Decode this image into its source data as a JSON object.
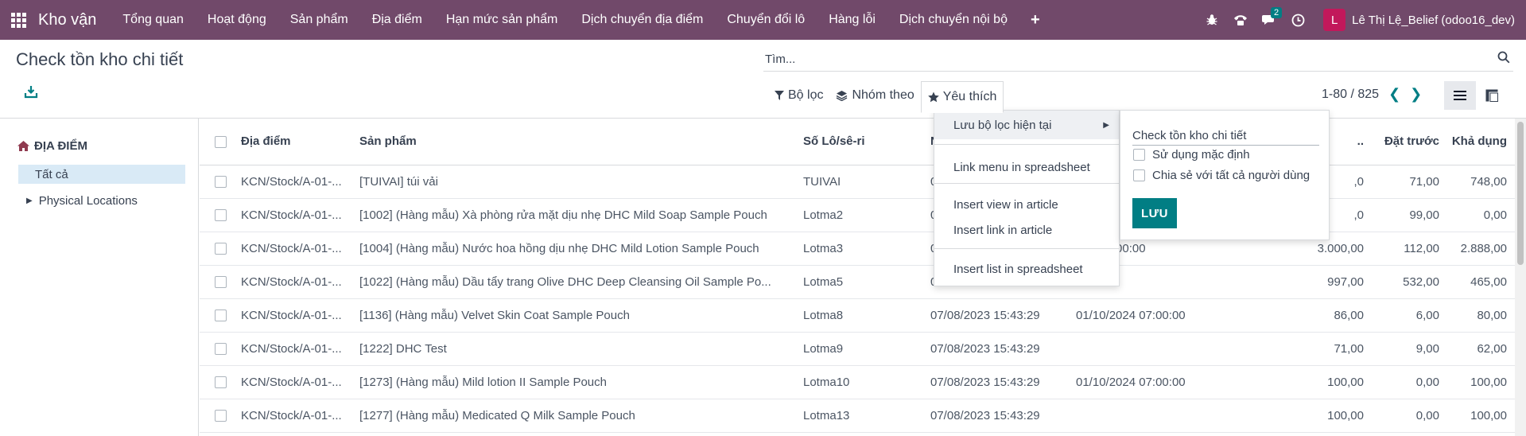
{
  "navbar": {
    "app_name": "Kho vận",
    "menus": [
      "Tổng quan",
      "Hoạt động",
      "Sản phẩm",
      "Địa điểm",
      "Hạn mức sản phẩm",
      "Dịch chuyển địa điểm",
      "Chuyển đổi lô",
      "Hàng lỗi",
      "Dịch chuyển nội bộ"
    ],
    "chat_badge": "2",
    "avatar_letter": "L",
    "user_name": "Lê Thị Lệ_Belief (odoo16_dev)"
  },
  "control_panel": {
    "title": "Check tồn kho chi tiết",
    "search_placeholder": "Tìm...",
    "filter_label": "Bộ lọc",
    "group_label": "Nhóm theo",
    "favorite_label": "Yêu thích",
    "pager": "1-80 / 825"
  },
  "sidebar": {
    "header": "ĐỊA ĐIỂM",
    "all_label": "Tất cả",
    "physical_label": "Physical Locations"
  },
  "table": {
    "headers": {
      "location": "Địa điểm",
      "product": "Sản phẩm",
      "lot": "Số Lô/sê-ri",
      "date_in": "N",
      "expiry": "",
      "qty": "..",
      "reserved": "Đặt trước",
      "available": "Khả dụng"
    },
    "rows": [
      {
        "location": "KCN/Stock/A-01-...",
        "product": "[TUIVAI] túi vải",
        "lot": "TUIVAI",
        "date_in": "0",
        "expiry": "",
        "qty": ",0",
        "reserved": "71,00",
        "available": "748,00"
      },
      {
        "location": "KCN/Stock/A-01-...",
        "product": "[1002] (Hàng mẫu) Xà phòng rửa mặt dịu nhẹ DHC Mild Soap Sample Pouch",
        "lot": "Lotma2",
        "date_in": "0",
        "expiry": "",
        "qty": ",0",
        "reserved": "99,00",
        "available": "0,00"
      },
      {
        "location": "KCN/Stock/A-01-...",
        "product": "[1004] (Hàng mẫu) Nước hoa hồng dịu nhẹ DHC Mild Lotion Sample Pouch",
        "lot": "Lotma3",
        "date_in": "0",
        "expiry": "023 07:00:00",
        "qty": "3.000,00",
        "reserved": "112,00",
        "available": "2.888,00"
      },
      {
        "location": "KCN/Stock/A-01-...",
        "product": "[1022] (Hàng mẫu) Dầu tẩy trang Olive DHC Deep Cleansing Oil Sample Po...",
        "lot": "Lotma5",
        "date_in": "0",
        "expiry": "",
        "qty": "997,00",
        "reserved": "532,00",
        "available": "465,00"
      },
      {
        "location": "KCN/Stock/A-01-...",
        "product": "[1136] (Hàng mẫu) Velvet Skin Coat Sample Pouch",
        "lot": "Lotma8",
        "date_in": "07/08/2023 15:43:29",
        "expiry": "01/10/2024 07:00:00",
        "qty": "86,00",
        "reserved": "6,00",
        "available": "80,00"
      },
      {
        "location": "KCN/Stock/A-01-...",
        "product": "[1222] DHC Test",
        "lot": "Lotma9",
        "date_in": "07/08/2023 15:43:29",
        "expiry": "",
        "qty": "71,00",
        "reserved": "9,00",
        "available": "62,00"
      },
      {
        "location": "KCN/Stock/A-01-...",
        "product": "[1273] (Hàng mẫu) Mild lotion II Sample Pouch",
        "lot": "Lotma10",
        "date_in": "07/08/2023 15:43:29",
        "expiry": "01/10/2024 07:00:00",
        "qty": "100,00",
        "reserved": "0,00",
        "available": "100,00"
      },
      {
        "location": "KCN/Stock/A-01-...",
        "product": "[1277] (Hàng mẫu) Medicated Q Milk Sample Pouch",
        "lot": "Lotma13",
        "date_in": "07/08/2023 15:43:29",
        "expiry": "",
        "qty": "100,00",
        "reserved": "0,00",
        "available": "100,00"
      }
    ]
  },
  "favorites_menu": {
    "save_current": "Lưu bộ lọc hiện tại",
    "link_menu": "Link menu in spreadsheet",
    "insert_view": "Insert view in article",
    "insert_link": "Insert link in article",
    "insert_list": "Insert list in spreadsheet"
  },
  "save_filter_panel": {
    "name_value": "Check tồn kho chi tiết",
    "default_label": "Sử dụng mặc định",
    "share_label": "Chia sẻ với tất cả người dùng",
    "save_button": "LƯU"
  },
  "colors": {
    "navbar": "#71496a",
    "primary": "#017e84",
    "selected_bg": "#d9eaf6"
  }
}
